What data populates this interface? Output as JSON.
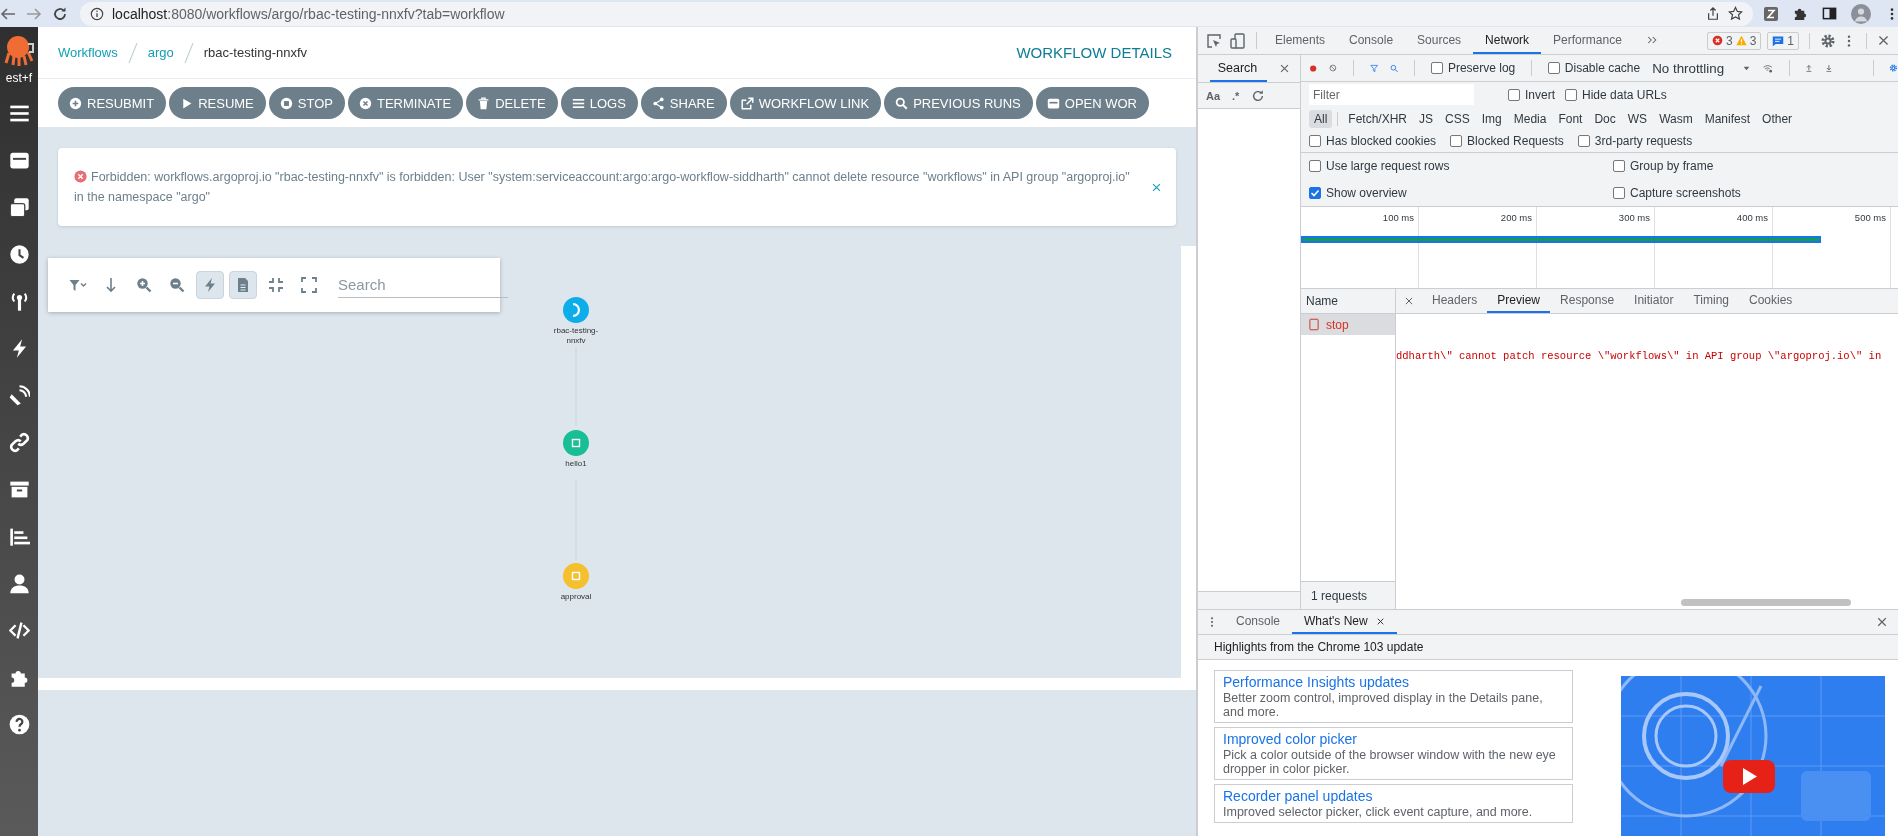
{
  "browser": {
    "address": {
      "host": "localhost",
      "path": ":8080/workflows/argo/rbac-testing-nnxfv?tab=workflow"
    }
  },
  "sidebar": {
    "account_label": "est+f"
  },
  "header": {
    "breadcrumbs": [
      "Workflows",
      "argo",
      "rbac-testing-nnxfv"
    ],
    "title": "WORKFLOW DETAILS"
  },
  "actions": [
    "RESUBMIT",
    "RESUME",
    "STOP",
    "TERMINATE",
    "DELETE",
    "LOGS",
    "SHARE",
    "WORKFLOW LINK",
    "PREVIOUS RUNS",
    "OPEN WOR"
  ],
  "alert": {
    "kind": "error",
    "message": "Forbidden: workflows.argoproj.io \"rbac-testing-nnxfv\" is forbidden: User \"system:serviceaccount:argo:argo-workflow-siddharth\" cannot delete resource \"workflows\" in API group \"argoproj.io\" in the namespace \"argo\""
  },
  "graph": {
    "toolbar_buttons": [
      {
        "selected": false
      },
      {
        "selected": false
      },
      {
        "selected": false
      },
      {
        "selected": false
      },
      {
        "selected": true
      },
      {
        "selected": true
      },
      {
        "selected": false
      },
      {
        "selected": false
      }
    ],
    "search": {
      "placeholder": "Search"
    },
    "nodes": [
      {
        "label": "rbac-testing-nnxfv",
        "kind": "running",
        "color": "#0dadea"
      },
      {
        "label": "hello1",
        "kind": "pod",
        "color": "#18be94"
      },
      {
        "label": "approval",
        "kind": "pod",
        "color": "#f4c030"
      }
    ]
  },
  "devtools": {
    "tabs": [
      {
        "label": "Elements",
        "selected": false
      },
      {
        "label": "Console",
        "selected": false
      },
      {
        "label": "Sources",
        "selected": false
      },
      {
        "label": "Network",
        "selected": true
      },
      {
        "label": "Performance",
        "selected": false
      }
    ],
    "errors": "3",
    "warnings": "3",
    "messages": "1",
    "search_pane": {
      "title": "Search",
      "options": [
        "Aa",
        ".*"
      ]
    },
    "network": {
      "preserve_log": {
        "label": "Preserve log",
        "checked": false
      },
      "disable_cache": {
        "label": "Disable cache",
        "checked": false
      },
      "throttling": "No throttling",
      "filter": {
        "placeholder": "Filter"
      },
      "invert": {
        "label": "Invert",
        "checked": false
      },
      "hide_data_urls": {
        "label": "Hide data URLs",
        "checked": false
      },
      "types": [
        {
          "label": "All",
          "selected": true
        },
        {
          "label": "Fetch/XHR",
          "selected": false
        },
        {
          "label": "JS",
          "selected": false
        },
        {
          "label": "CSS",
          "selected": false
        },
        {
          "label": "Img",
          "selected": false
        },
        {
          "label": "Media",
          "selected": false
        },
        {
          "label": "Font",
          "selected": false
        },
        {
          "label": "Doc",
          "selected": false
        },
        {
          "label": "WS",
          "selected": false
        },
        {
          "label": "Wasm",
          "selected": false
        },
        {
          "label": "Manifest",
          "selected": false
        },
        {
          "label": "Other",
          "selected": false
        }
      ],
      "options": [
        {
          "label": "Has blocked cookies",
          "checked": false
        },
        {
          "label": "Blocked Requests",
          "checked": false
        },
        {
          "label": "3rd-party requests",
          "checked": false
        }
      ],
      "settings": [
        {
          "label": "Use large request rows",
          "checked": false
        },
        {
          "label": "Group by frame",
          "checked": false
        },
        {
          "label": "Show overview",
          "checked": true
        },
        {
          "label": "Capture screenshots",
          "checked": false
        }
      ],
      "overview_ticks": [
        "100 ms",
        "200 ms",
        "300 ms",
        "400 ms",
        "500 ms"
      ],
      "name_header": "Name",
      "requests": [
        {
          "name": "stop",
          "failed": true,
          "selected": true
        }
      ],
      "detail_tabs": [
        {
          "label": "Headers",
          "selected": false
        },
        {
          "label": "Preview",
          "selected": true
        },
        {
          "label": "Response",
          "selected": false
        },
        {
          "label": "Initiator",
          "selected": false
        },
        {
          "label": "Timing",
          "selected": false
        },
        {
          "label": "Cookies",
          "selected": false
        }
      ],
      "preview": "ddharth\\\" cannot patch resource \\\"workflows\\\" in API group \\\"argoproj.io\\\" in",
      "summary": "1 requests"
    }
  },
  "drawer": {
    "tabs": [
      {
        "label": "Console",
        "selected": false,
        "closable": false
      },
      {
        "label": "What's New",
        "selected": true,
        "closable": true
      }
    ],
    "heading": "Highlights from the Chrome 103 update",
    "cards": [
      {
        "title": "Performance Insights updates",
        "description": "Better zoom control, improved display in the Details pane, and more."
      },
      {
        "title": "Improved color picker",
        "description": "Pick a color outside of the browser window with the new eye dropper in color picker."
      },
      {
        "title": "Recorder panel updates",
        "description": "Improved selector picker, click event capture, and more."
      }
    ]
  }
}
